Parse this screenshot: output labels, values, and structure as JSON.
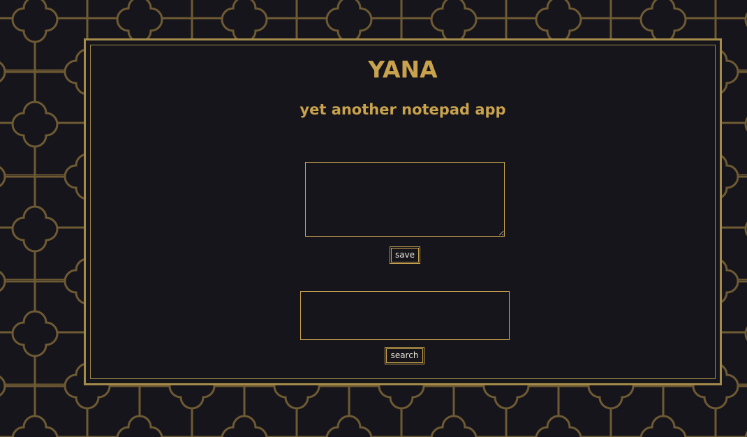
{
  "app": {
    "title": "YANA",
    "subtitle": "yet another notepad app"
  },
  "note": {
    "value": "",
    "placeholder": ""
  },
  "actions": {
    "save_label": "save",
    "search_label": "search"
  },
  "search": {
    "value": "",
    "placeholder": ""
  },
  "colors": {
    "background": "#16151b",
    "accent": "#c9a24e",
    "pattern": "#6e5a33",
    "button_text": "#e9e4d6"
  }
}
